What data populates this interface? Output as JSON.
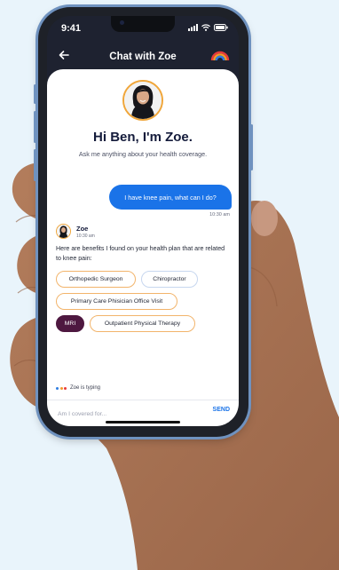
{
  "status_bar": {
    "time": "9:41"
  },
  "nav": {
    "title": "Chat with Zoe",
    "back_icon": "arrow-left-icon",
    "brand_icon": "rainbow-icon"
  },
  "header": {
    "greeting": "Hi Ben, I'm Zoe.",
    "subtitle": "Ask me anything about your health coverage."
  },
  "messages": {
    "user": {
      "text": "I have knee pain, what can I do?",
      "time": "10:30 am"
    },
    "assistant": {
      "name": "Zoe",
      "time": "10:30 am",
      "text": "Here are benefits I found on your health plan that are related to knee pain:"
    }
  },
  "chips": [
    {
      "label": "Orthopedic Surgeon",
      "selected": false
    },
    {
      "label": "Chiropractor",
      "selected": false
    },
    {
      "label": "Primary Care Phisician Office Visit",
      "selected": false
    },
    {
      "label": "MRI",
      "selected": true
    },
    {
      "label": "Outpatient Physical Therapy",
      "selected": false
    }
  ],
  "typing_indicator": {
    "text": "Zoe is typing"
  },
  "composer": {
    "placeholder": "Am I covered for...",
    "send_label": "SEND"
  },
  "colors": {
    "accent": "#1a73e8",
    "selected_chip": "#4e1840",
    "avatar_ring": "#f0a63a",
    "phone_frame": "#6f92bf",
    "title_text": "#141b3b"
  }
}
